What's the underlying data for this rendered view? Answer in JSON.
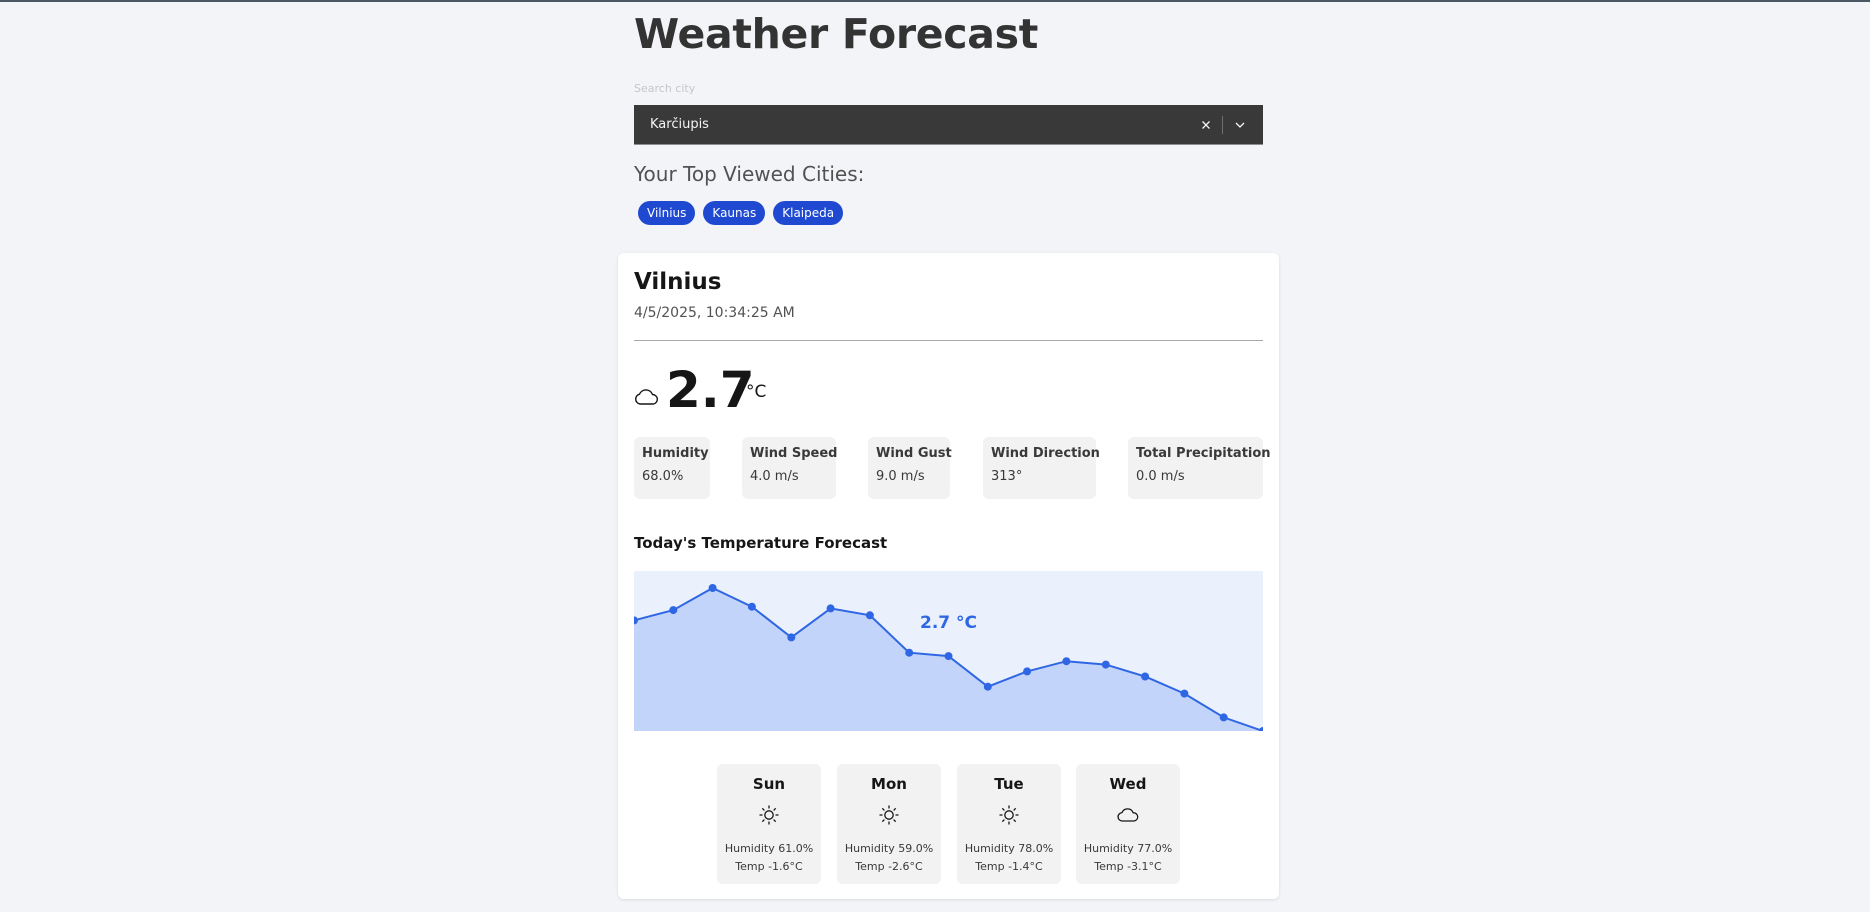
{
  "header": {
    "title": "Weather Forecast"
  },
  "search": {
    "label": "Search city",
    "value": "Karčiupis",
    "clear_icon": "close-icon",
    "toggle_icon": "chevron-down-icon"
  },
  "top_cities": {
    "title": "Your Top Viewed Cities:",
    "items": [
      {
        "label": "Vilnius"
      },
      {
        "label": "Kaunas"
      },
      {
        "label": "Klaipeda"
      }
    ],
    "chip_color": "#1f49d1"
  },
  "current": {
    "city": "Vilnius",
    "datetime": "4/5/2025, 10:34:25 AM",
    "icon": "cloud-icon",
    "temperature": "2.7",
    "unit": "°C",
    "stats": [
      {
        "label": "Humidity",
        "value": "68.0%"
      },
      {
        "label": "Wind Speed",
        "value": "4.0 m/s"
      },
      {
        "label": "Wind Gust",
        "value": "9.0 m/s"
      },
      {
        "label": "Wind Direction",
        "value": "313°"
      },
      {
        "label": "Total Precipitation",
        "value": "0.0 m/s"
      }
    ]
  },
  "forecast_chart": {
    "title": "Today's Temperature Forecast",
    "annotation": "2.7 °C",
    "line_color": "#2f66e3",
    "area_color": "#c3d4fa",
    "background_color": "#eaf0fc"
  },
  "chart_data": {
    "type": "area",
    "title": "Today's Temperature Forecast",
    "annotations": [
      "2.7 °C"
    ],
    "y_unit": "°C",
    "values": [
      3.9,
      4.5,
      5.8,
      4.7,
      2.9,
      4.6,
      4.2,
      2.0,
      1.8,
      0.0,
      0.9,
      1.5,
      1.3,
      0.6,
      -0.4,
      -1.8,
      -2.6
    ],
    "ylim": [
      -2.6,
      6.8
    ],
    "grid": false,
    "legend": "none"
  },
  "days": [
    {
      "name": "Sun",
      "icon": "sun-icon",
      "humidity": "Humidity 61.0%",
      "temp": "Temp -1.6°C"
    },
    {
      "name": "Mon",
      "icon": "sun-icon",
      "humidity": "Humidity 59.0%",
      "temp": "Temp -2.6°C"
    },
    {
      "name": "Tue",
      "icon": "sun-icon",
      "humidity": "Humidity 78.0%",
      "temp": "Temp -1.4°C"
    },
    {
      "name": "Wed",
      "icon": "cloud-icon",
      "humidity": "Humidity 77.0%",
      "temp": "Temp -3.1°C"
    }
  ]
}
